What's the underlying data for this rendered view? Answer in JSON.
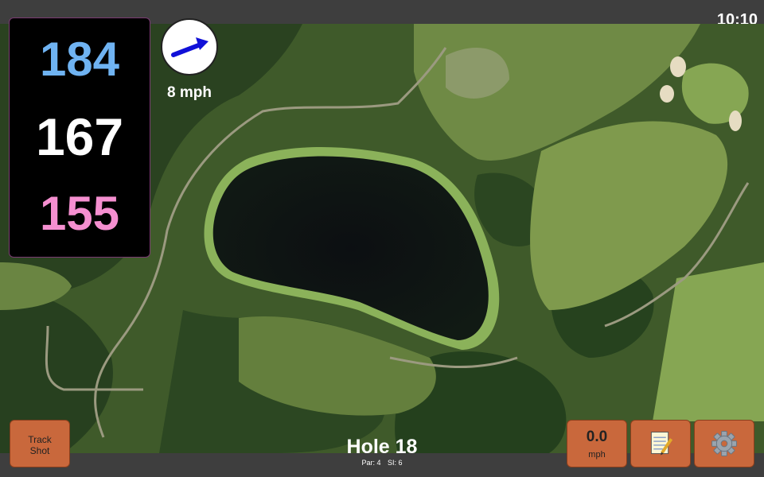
{
  "status": {
    "time": "10:10"
  },
  "distances": {
    "back": "184",
    "middle": "167",
    "front": "155"
  },
  "wind": {
    "speed": "8 mph"
  },
  "track_button": {
    "line1": "Track",
    "line2": "Shot"
  },
  "hole": {
    "title": "Hole 18",
    "par": "Par: 4",
    "si": "SI: 6"
  },
  "speed_button": {
    "value": "0.0",
    "unit": "mph"
  },
  "icons": {
    "wind": "wind-arrow-icon",
    "notes": "notepad-icon",
    "settings": "gear-icon"
  },
  "colors": {
    "back": "#6fb3f2",
    "middle": "#ffffff",
    "front": "#f58fd0",
    "button": "#c9683c",
    "arrow": "#1010d8"
  }
}
